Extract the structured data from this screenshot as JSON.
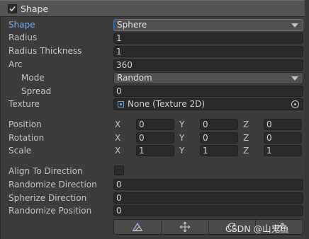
{
  "module": {
    "enabled": true,
    "title": "Shape"
  },
  "rows": {
    "shape": {
      "label": "Shape",
      "value": "Sphere"
    },
    "radius": {
      "label": "Radius",
      "value": "1"
    },
    "radius_thickness": {
      "label": "Radius Thickness",
      "value": "1"
    },
    "arc": {
      "label": "Arc",
      "value": "360"
    },
    "mode": {
      "label": "Mode",
      "value": "Random"
    },
    "spread": {
      "label": "Spread",
      "value": "0"
    },
    "texture": {
      "label": "Texture",
      "value": "None (Texture 2D)"
    },
    "position": {
      "label": "Position",
      "x": "0",
      "y": "0",
      "z": "0"
    },
    "rotation": {
      "label": "Rotation",
      "x": "0",
      "y": "0",
      "z": "0"
    },
    "scale": {
      "label": "Scale",
      "x": "1",
      "y": "1",
      "z": "1"
    },
    "align_to_direction": {
      "label": "Align To Direction",
      "checked": false
    },
    "randomize_direction": {
      "label": "Randomize Direction",
      "value": "0"
    },
    "spherize_direction": {
      "label": "Spherize Direction",
      "value": "0"
    },
    "randomize_position": {
      "label": "Randomize Position",
      "value": "0"
    }
  },
  "axis_labels": {
    "x": "X",
    "y": "Y",
    "z": "Z"
  },
  "toolbar": {
    "buttons": [
      "edit-shape-icon",
      "move-icon",
      "rotate-icon",
      "scale-icon"
    ]
  },
  "watermark": "CSDN @山鬼鱼",
  "colors": {
    "accent": "#7aa9e6",
    "panel": "#3c3c3c",
    "header": "#545454",
    "field": "#2a2a2a"
  }
}
